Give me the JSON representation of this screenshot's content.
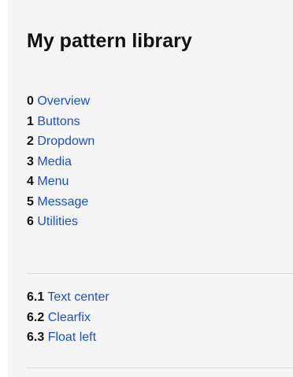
{
  "title": "My pattern library",
  "nav": [
    {
      "number": "0",
      "label": "Overview"
    },
    {
      "number": "1",
      "label": "Buttons"
    },
    {
      "number": "2",
      "label": "Dropdown"
    },
    {
      "number": "3",
      "label": "Media"
    },
    {
      "number": "4",
      "label": "Menu"
    },
    {
      "number": "5",
      "label": "Message"
    },
    {
      "number": "6",
      "label": "Utilities"
    }
  ],
  "subnav": [
    {
      "number": "6.1",
      "label": "Text center",
      "active": true
    },
    {
      "number": "6.2",
      "label": "Clearfix"
    },
    {
      "number": "6.3",
      "label": "Float left"
    }
  ],
  "colors": {
    "link": "#1a4fd0",
    "sidebar_background": "#f5f5f5",
    "active_marker": "#111111"
  }
}
